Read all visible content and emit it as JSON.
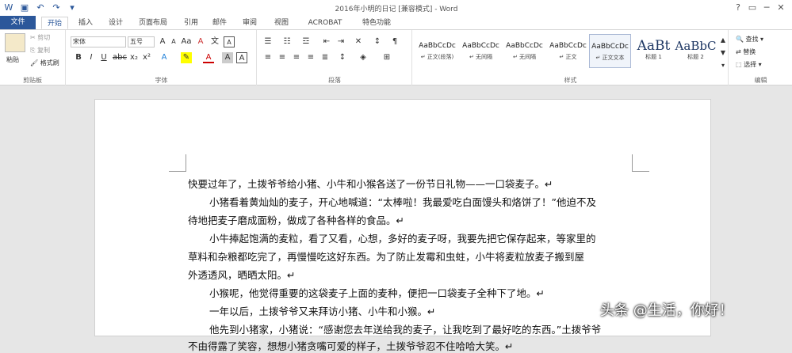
{
  "window": {
    "title": "2016年小明的日记 [兼容模式] - Word",
    "controls": [
      "?",
      "▭",
      "─",
      "□",
      "✕"
    ]
  },
  "tabs": [
    "文件",
    "开始",
    "插入",
    "设计",
    "页面布局",
    "引用",
    "邮件",
    "审阅",
    "视图",
    "ACROBAT",
    "特色功能"
  ],
  "ribbon": {
    "clipboard": {
      "paste": "粘贴",
      "cut": "剪切",
      "copy": "复制",
      "format_painter": "格式刷",
      "label": "剪贴板"
    },
    "font": {
      "name": "宋体",
      "size": "五号",
      "label": "字体"
    },
    "paragraph": {
      "label": "段落"
    },
    "styles": {
      "label": "样式",
      "items": [
        {
          "preview": "AaBbCcDc",
          "name": "↵ 正文(段落)"
        },
        {
          "preview": "AaBbCcDc",
          "name": "↵ 无间隔"
        },
        {
          "preview": "AaBbCcDc",
          "name": "↵ 无间隔"
        },
        {
          "preview": "AaBbCcDc",
          "name": "↵ 正文"
        },
        {
          "preview": "AaBbCcDc",
          "name": "↵ 正文文本"
        },
        {
          "preview": "AaBt",
          "name": "标题 1"
        },
        {
          "preview": "AaBbC",
          "name": "标题 2"
        }
      ]
    },
    "editing": {
      "find": "查找",
      "replace": "替换",
      "select": "选择",
      "label": "编辑"
    }
  },
  "document": {
    "paragraphs": [
      "快要过年了，土拨爷爷给小猪、小牛和小猴各送了一份节日礼物——一口袋麦子。↵",
      "小猪看着黄灿灿的麦子，开心地喊道：“太棒啦！我最爱吃白面馒头和烙饼了！”他迫不及",
      "待地把麦子磨成面粉，做成了各种各样的食品。↵",
      "小牛捧起饱满的麦粒，看了又看，心想，多好的麦子呀，我要先把它保存起来，等家里的",
      "草料和杂粮都吃完了，再慢慢吃这好东西。为了防止发霉和虫蛀，小牛将麦粒放麦子搬到屋",
      "外透透风，晒晒太阳。↵",
      "小猴呢，他觉得重要的这袋麦子上面的麦种，便把一口袋麦子全种下了地。↵",
      "一年以后，土拨爷爷又来拜访小猪、小牛和小猴。↵",
      "他先到小猪家，小猪说：“感谢您去年送给我的麦子，让我吃到了最好吃的东西。”土拨爷爷",
      "不由得露了笑容，想想小猪贪嘴可爱的样子，土拨爷爷忍不住哈哈大笑。↵"
    ]
  },
  "watermark": "头条 @生活，你好！"
}
